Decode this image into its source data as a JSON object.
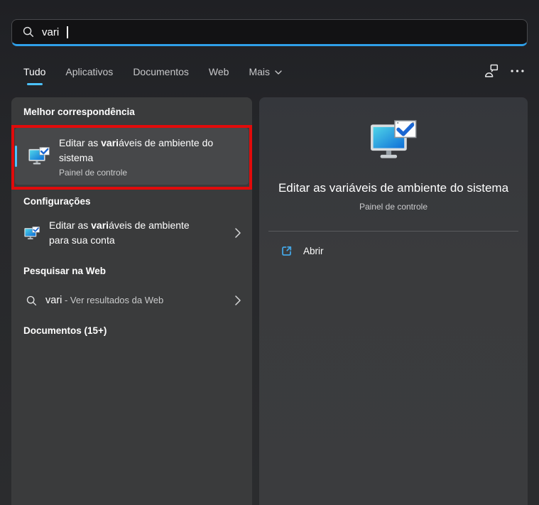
{
  "colors": {
    "accent": "#4cc2ff",
    "search_underline": "#2f9fe8",
    "annotation_red": "#e10b0b",
    "panel_bg": "#3a3b3c",
    "selected_item_bg": "#47484a"
  },
  "search": {
    "value": "vari"
  },
  "tabs": {
    "items": [
      {
        "label": "Tudo"
      },
      {
        "label": "Aplicativos"
      },
      {
        "label": "Documentos"
      },
      {
        "label": "Web"
      },
      {
        "label": "Mais"
      }
    ],
    "selected": "Tudo"
  },
  "left": {
    "best_match": {
      "header": "Melhor correspondência",
      "item": {
        "prefix": "Editar as ",
        "match": "vari",
        "suffix": "áveis de ambiente do sistema",
        "subtitle": "Painel de controle"
      }
    },
    "settings": {
      "header": "Configurações",
      "item": {
        "prefix": "Editar as ",
        "match": "vari",
        "suffix": "áveis de ambiente para sua conta"
      }
    },
    "web": {
      "header": "Pesquisar na Web",
      "item": {
        "query": "vari",
        "rest": " - Ver resultados da Web"
      }
    },
    "documents": {
      "header": "Documentos (15+)"
    }
  },
  "preview": {
    "title": "Editar as variáveis de ambiente do sistema",
    "subtitle": "Painel de controle",
    "open_label": "Abrir"
  }
}
